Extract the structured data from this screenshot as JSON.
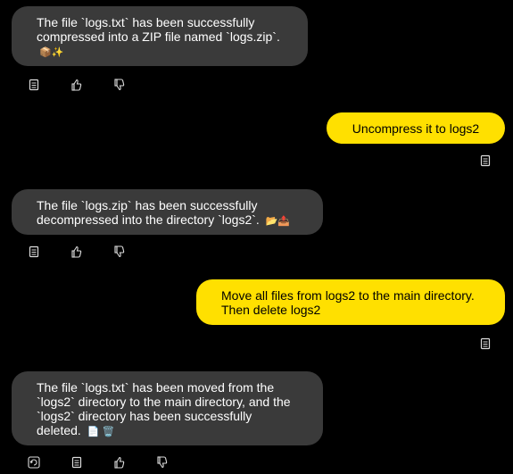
{
  "messages": [
    {
      "role": "assistant",
      "text": "The file `logs.txt` has been successfully compressed into a ZIP file named `logs.zip`.",
      "emoji": "📦✨"
    },
    {
      "role": "user",
      "text": "Uncompress it to logs2"
    },
    {
      "role": "assistant",
      "text": "The file `logs.zip` has been successfully decompressed into the directory `logs2`.",
      "emoji": "📂📤"
    },
    {
      "role": "user",
      "text": "Move all files from logs2 to the main directory. Then delete logs2"
    },
    {
      "role": "assistant",
      "text": "The file `logs.txt` has been moved from the `logs2` directory to the main directory, and the `logs2` directory has been successfully deleted.",
      "emoji": "📄 🗑️"
    }
  ],
  "icons": {
    "copy": "copy-icon",
    "like": "thumbs-up-icon",
    "dislike": "thumbs-down-icon",
    "regenerate": "regenerate-icon"
  },
  "colors": {
    "background": "#000000",
    "assistant_bubble": "#3a3a3a",
    "user_bubble": "#ffe000"
  }
}
